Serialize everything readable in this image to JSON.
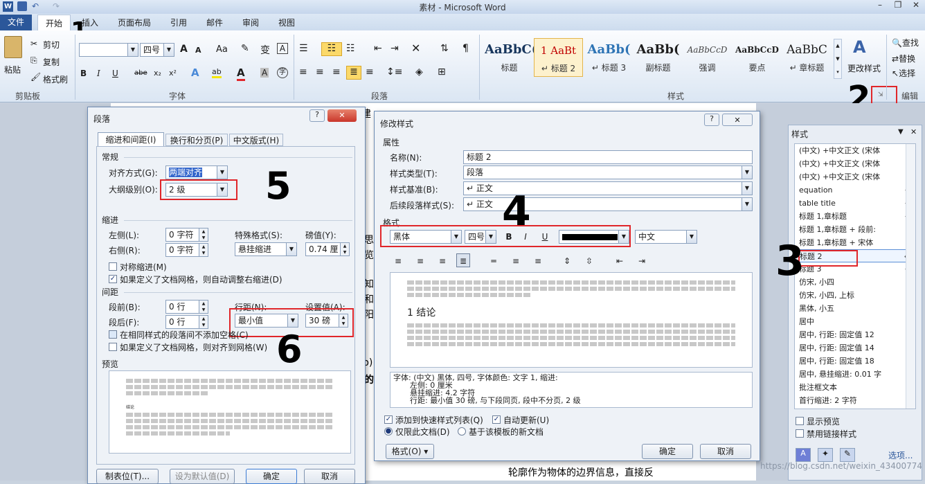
{
  "app": {
    "title": "素材 - Microsoft Word"
  },
  "tabs": [
    "插入",
    "页面布局",
    "引用",
    "邮件",
    "审阅",
    "视图"
  ],
  "file_tab": "文件",
  "home_tab": "开始",
  "clipboard": {
    "paste": "粘贴",
    "cut": "剪切",
    "copy": "复制",
    "painter": "格式刷",
    "label": "剪贴板"
  },
  "font": {
    "size": "四号",
    "label": "字体",
    "size_up": "A",
    "size_down": "A",
    "aa": "Aa"
  },
  "paragraph_label": "段落",
  "styles": {
    "label": "样式",
    "items": [
      {
        "sample": "AaBbC(",
        "name": "标题"
      },
      {
        "sample": "1  AaBt",
        "name": "↵ 标题 2"
      },
      {
        "sample": "AaBb(",
        "name": "↵ 标题 3"
      },
      {
        "sample": "AaBb(",
        "name": "副标题"
      },
      {
        "sample": "AaBbCcD",
        "name": "强调"
      },
      {
        "sample": "AaBbCcD",
        "name": "要点"
      },
      {
        "sample": "AaBbC",
        "name": "↵ 章标题"
      }
    ],
    "change": "更改样式"
  },
  "edit": {
    "find": "查找",
    "replace": "替换",
    "select": "选择",
    "label": "编辑"
  },
  "para_dialog": {
    "title": "段落",
    "tabs": [
      "缩进和间距(I)",
      "换行和分页(P)",
      "中文版式(H)"
    ],
    "general": "常规",
    "align_label": "对齐方式(G):",
    "align_value": "两端对齐",
    "outline_label": "大纲级别(O):",
    "outline_value": "2 级",
    "indent": "缩进",
    "left_label": "左侧(L):",
    "left_value": "0 字符",
    "right_label": "右侧(R):",
    "right_value": "0 字符",
    "special_label": "特殊格式(S):",
    "special_value": "悬挂缩进",
    "by_label": "磅值(Y):",
    "by_value": "0.74 厘",
    "mirror": "对称缩进(M)",
    "auto_right": "如果定义了文档网格，则自动调整右缩进(D)",
    "spacing": "间距",
    "before_label": "段前(B):",
    "before_value": "0 行",
    "after_label": "段后(F):",
    "after_value": "0 行",
    "line_label": "行距(N):",
    "line_value": "最小值",
    "at_label": "设置值(A):",
    "at_value": "30 磅",
    "no_space": "在相同样式的段落间不添加空格(C)",
    "snap": "如果定义了文档网格，则对齐到网格(W)",
    "preview": "预览",
    "preview_head": "结论",
    "tabs_btn": "制表位(T)...",
    "default_btn": "设为默认值(D)",
    "ok": "确定",
    "cancel": "取消"
  },
  "mod_dialog": {
    "title": "修改样式",
    "props": "属性",
    "name_label": "名称(N):",
    "name_value": "标题 2",
    "type_label": "样式类型(T):",
    "type_value": "段落",
    "based_label": "样式基准(B):",
    "based_value": "↵ 正文",
    "next_label": "后续段落样式(S):",
    "next_value": "↵ 正文",
    "format": "格式",
    "font_value": "黑体",
    "size_value": "四号",
    "b": "B",
    "i": "I",
    "u": "U",
    "lang_value": "中文",
    "preview_head": "1   结论",
    "desc_l1": "字体: (中文) 黑体, 四号, 字体颜色: 文字 1, 缩进:",
    "desc_l2": "左侧:  0 厘米",
    "desc_l3": "悬挂缩进: 4.2 字符",
    "desc_l4": "行距: 最小值 30 磅, 与下段同页, 段中不分页, 2 级",
    "add_quick": "添加到快速样式列表(Q)",
    "auto_update": "自动更新(U)",
    "only_doc": "仅限此文档(D)",
    "new_docs": "基于该模板的新文档",
    "format_btn": "格式(O) ▾",
    "ok": "确定",
    "cancel": "取消"
  },
  "style_pane": {
    "title": "样式",
    "items": [
      {
        "t": "(中文) +中文正文 (宋体",
        "m": ""
      },
      {
        "t": "(中文) +中文正文 (宋体",
        "m": ""
      },
      {
        "t": "(中文) +中文正文 (宋体",
        "m": ""
      },
      {
        "t": "equation",
        "m": "↵"
      },
      {
        "t": "table title",
        "m": "↵"
      },
      {
        "t": "标题 1,章标题",
        "m": "↵"
      },
      {
        "t": "标题 1,章标题 + 段前:",
        "m": ""
      },
      {
        "t": "标题 1,章标题 + 宋体",
        "m": ""
      },
      {
        "t": "标题 2",
        "m": "↵"
      },
      {
        "t": "标题 3",
        "m": "↵"
      },
      {
        "t": "仿宋, 小四",
        "m": ""
      },
      {
        "t": "仿宋, 小四, 上标",
        "m": ""
      },
      {
        "t": "黑体, 小五",
        "m": ""
      },
      {
        "t": "居中",
        "m": ""
      },
      {
        "t": "居中, 行距: 固定值 12",
        "m": ""
      },
      {
        "t": "居中, 行距: 固定值 14",
        "m": ""
      },
      {
        "t": "居中, 行距: 固定值 18",
        "m": ""
      },
      {
        "t": "居中, 悬挂缩进: 0.01 字",
        "m": ""
      },
      {
        "t": "批注框文本",
        "m": ""
      },
      {
        "t": "首行缩进:  2 字符",
        "m": ""
      }
    ],
    "show_preview": "显示预览",
    "disable_linked": "禁用链接样式",
    "options": "选项..."
  },
  "doc": {
    "line_bottom": "轮廓作为物体的边界信息，直接反",
    "frag_jian": "建",
    "frag_b": "b)",
    "frag_de": "的",
    "left_chars": [
      "思",
      "览",
      "知",
      "和",
      "阳"
    ]
  },
  "annotations": {
    "n1": "1",
    "n2": "2",
    "n3": "3",
    "n4": "4",
    "n5": "5",
    "n6": "6"
  },
  "watermark": "https://blog.csdn.net/weixin_43400774"
}
